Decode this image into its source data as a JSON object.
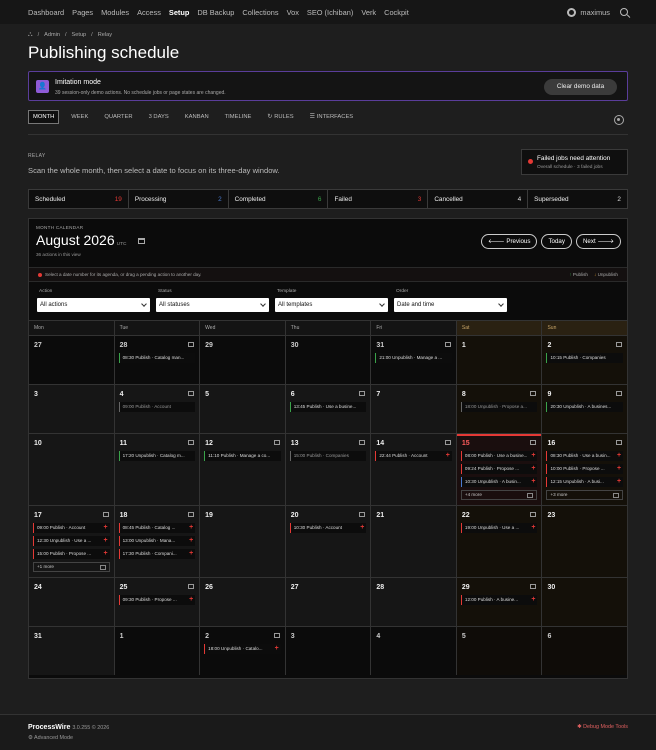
{
  "nav": {
    "items": [
      {
        "label": "Dashboard",
        "active": false
      },
      {
        "label": "Pages",
        "active": false
      },
      {
        "label": "Modules",
        "active": false
      },
      {
        "label": "Access",
        "active": false
      },
      {
        "label": "Setup",
        "active": true
      },
      {
        "label": "DB Backup",
        "active": false
      },
      {
        "label": "Collections",
        "active": false
      },
      {
        "label": "Vox",
        "active": false
      },
      {
        "label": "SEO (Ichiban)",
        "active": false
      },
      {
        "label": "Verk",
        "active": false
      },
      {
        "label": "Cockpit",
        "active": false
      }
    ],
    "user": "maximus",
    "user_icon": "user-circle-icon",
    "search_icon": "search-icon"
  },
  "breadcrumb": {
    "home_icon": "sitemap-icon",
    "items": [
      "Admin",
      "Setup",
      "Relay"
    ],
    "separator": "/"
  },
  "page_title": "Publishing schedule",
  "notice": {
    "icon": "user-icon",
    "title": "Imitation mode",
    "text": "39 session-only demo actions. No schedule jobs or page states are changed.",
    "button": "Clear demo data",
    "accent": "#8e5bd6"
  },
  "tabs": [
    {
      "label": "MONTH",
      "active": true,
      "icon": ""
    },
    {
      "label": "WEEK",
      "active": false,
      "icon": ""
    },
    {
      "label": "QUARTER",
      "active": false,
      "icon": ""
    },
    {
      "label": "3 DAYS",
      "active": false,
      "icon": ""
    },
    {
      "label": "KANBAN",
      "active": false,
      "icon": ""
    },
    {
      "label": "TIMELINE",
      "active": false,
      "icon": ""
    },
    {
      "label": "RULES",
      "active": false,
      "icon": "↻"
    },
    {
      "label": "INTERFACES",
      "active": false,
      "icon": "☰"
    }
  ],
  "settings_icon": "gear-icon",
  "relay": {
    "label": "RELAY",
    "text": "Scan the whole month, then select a date to focus on its three-day window."
  },
  "failed_alert": {
    "title": "Failed jobs need attention",
    "subtitle": "Overall schedule · 3 failed jobs"
  },
  "stats": [
    {
      "label": "Scheduled",
      "count": "19",
      "color": "#e53935"
    },
    {
      "label": "Processing",
      "count": "2",
      "color": "#4a7bd0"
    },
    {
      "label": "Completed",
      "count": "6",
      "color": "#3aa34a"
    },
    {
      "label": "Failed",
      "count": "3",
      "color": "#e53935"
    },
    {
      "label": "Cancelled",
      "count": "4",
      "color": "#dddddd"
    },
    {
      "label": "Superseded",
      "count": "2",
      "color": "#dddddd"
    }
  ],
  "calendar": {
    "kicker": "MONTH CALENDAR",
    "month": "August 2026",
    "tz": "UTC",
    "count": "36 actions in this view",
    "buttons": {
      "prev": "Previous",
      "today": "Today",
      "next": "Next"
    },
    "hint": "Select a date number for its agenda, or drag a pending action to another day.",
    "legend": {
      "publish": "Publish",
      "unpublish": "Unpublish",
      "publish_color": "#3aa34a",
      "unpublish_color": "#e0a030"
    },
    "filters": [
      {
        "label": "Action",
        "value": "All actions"
      },
      {
        "label": "Status",
        "value": "All statuses"
      },
      {
        "label": "Template",
        "value": "All templates"
      },
      {
        "label": "Order",
        "value": "Date and time"
      }
    ],
    "weekdays": [
      "Mon",
      "Tue",
      "Wed",
      "Thu",
      "Fri",
      "Sat",
      "Sun"
    ],
    "weeks": [
      [
        {
          "day": "27",
          "dim": true,
          "cal": false,
          "events": []
        },
        {
          "day": "28",
          "dim": true,
          "cal": true,
          "events": [
            {
              "text": "08:30 Publish · Catalog man...",
              "type": "pub",
              "plus": false
            }
          ]
        },
        {
          "day": "29",
          "dim": true,
          "cal": false,
          "events": []
        },
        {
          "day": "30",
          "dim": true,
          "cal": false,
          "events": []
        },
        {
          "day": "31",
          "dim": true,
          "cal": true,
          "events": [
            {
              "text": "21:00 Unpublish · Manage a ...",
              "type": "pub",
              "plus": false
            }
          ]
        },
        {
          "day": "1",
          "dim": false,
          "cal": false,
          "events": []
        },
        {
          "day": "2",
          "dim": false,
          "cal": true,
          "events": [
            {
              "text": "10:15 Publish · Companies",
              "type": "pub",
              "plus": false
            }
          ]
        }
      ],
      [
        {
          "day": "3",
          "dim": false,
          "cal": false,
          "events": []
        },
        {
          "day": "4",
          "dim": false,
          "cal": true,
          "events": [
            {
              "text": "09:00 Publish · Account",
              "type": "done",
              "plus": false
            }
          ]
        },
        {
          "day": "5",
          "dim": false,
          "cal": false,
          "events": []
        },
        {
          "day": "6",
          "dim": false,
          "cal": true,
          "events": [
            {
              "text": "13:45 Publish · Use a busine...",
              "type": "pub",
              "plus": false
            }
          ]
        },
        {
          "day": "7",
          "dim": false,
          "cal": false,
          "events": []
        },
        {
          "day": "8",
          "dim": false,
          "cal": true,
          "events": [
            {
              "text": "18:00 Unpublish · Propose a...",
              "type": "done",
              "plus": false
            }
          ]
        },
        {
          "day": "9",
          "dim": false,
          "cal": true,
          "events": [
            {
              "text": "20:30 Unpublish · A busines...",
              "type": "pub",
              "plus": false
            }
          ]
        }
      ],
      [
        {
          "day": "10",
          "dim": false,
          "cal": false,
          "events": []
        },
        {
          "day": "11",
          "dim": false,
          "cal": true,
          "events": [
            {
              "text": "17:20 Unpublish · Catalog m...",
              "type": "pub",
              "plus": false
            }
          ]
        },
        {
          "day": "12",
          "dim": false,
          "cal": true,
          "events": [
            {
              "text": "11:10 Publish · Manage a co...",
              "type": "pub",
              "plus": false
            }
          ]
        },
        {
          "day": "13",
          "dim": false,
          "cal": true,
          "events": [
            {
              "text": "15:00 Publish · Companies",
              "type": "done",
              "plus": false
            }
          ]
        },
        {
          "day": "14",
          "dim": false,
          "cal": true,
          "events": [
            {
              "text": "22:44 Publish · Account",
              "type": "unpub",
              "plus": true
            }
          ]
        },
        {
          "day": "15",
          "dim": false,
          "cal": true,
          "today": true,
          "events": [
            {
              "text": "08:00 Publish · Use a busine...",
              "type": "unpub",
              "plus": true
            },
            {
              "text": "09:24 Publish · Propose ...",
              "type": "unpub",
              "plus": true
            },
            {
              "text": "10:30 Unpublish · A busin...",
              "type": "info",
              "plus": true
            }
          ],
          "more": "+4 more"
        },
        {
          "day": "16",
          "dim": false,
          "cal": true,
          "events": [
            {
              "text": "08:30 Publish · Use a busin...",
              "type": "unpub",
              "plus": true
            },
            {
              "text": "10:00 Publish · Propose ...",
              "type": "unpub",
              "plus": true
            },
            {
              "text": "12:15 Unpublish · A busi...",
              "type": "unpub",
              "plus": true
            }
          ],
          "more": "+3 more"
        }
      ],
      [
        {
          "day": "17",
          "dim": false,
          "cal": true,
          "events": [
            {
              "text": "09:00 Publish · Account",
              "type": "unpub",
              "plus": true
            },
            {
              "text": "12:30 Unpublish · Use a ...",
              "type": "unpub",
              "plus": true
            },
            {
              "text": "15:00 Publish · Propose ...",
              "type": "unpub",
              "plus": true
            }
          ],
          "more": "+1 more"
        },
        {
          "day": "18",
          "dim": false,
          "cal": true,
          "events": [
            {
              "text": "08:45 Publish · Catalog ...",
              "type": "unpub",
              "plus": true
            },
            {
              "text": "13:00 Unpublish · Mana...",
              "type": "unpub",
              "plus": true
            },
            {
              "text": "17:30 Publish · Compani...",
              "type": "unpub",
              "plus": true
            }
          ]
        },
        {
          "day": "19",
          "dim": false,
          "cal": false,
          "events": []
        },
        {
          "day": "20",
          "dim": false,
          "cal": true,
          "events": [
            {
              "text": "10:30 Publish · Account",
              "type": "unpub",
              "plus": true
            }
          ]
        },
        {
          "day": "21",
          "dim": false,
          "cal": false,
          "events": []
        },
        {
          "day": "22",
          "dim": false,
          "cal": true,
          "events": [
            {
              "text": "19:00 Unpublish · Use a ...",
              "type": "unpub",
              "plus": true
            }
          ]
        },
        {
          "day": "23",
          "dim": false,
          "cal": false,
          "events": []
        }
      ],
      [
        {
          "day": "24",
          "dim": false,
          "cal": false,
          "events": []
        },
        {
          "day": "25",
          "dim": false,
          "cal": true,
          "events": [
            {
              "text": "09:30 Publish · Propose ...",
              "type": "unpub",
              "plus": true
            }
          ]
        },
        {
          "day": "26",
          "dim": false,
          "cal": false,
          "events": []
        },
        {
          "day": "27",
          "dim": false,
          "cal": false,
          "events": []
        },
        {
          "day": "28",
          "dim": false,
          "cal": false,
          "events": []
        },
        {
          "day": "29",
          "dim": false,
          "cal": true,
          "events": [
            {
              "text": "12:00 Publish · A busine...",
              "type": "unpub",
              "plus": true
            }
          ]
        },
        {
          "day": "30",
          "dim": false,
          "cal": false,
          "events": []
        }
      ],
      [
        {
          "day": "31",
          "dim": false,
          "cal": false,
          "events": []
        },
        {
          "day": "1",
          "dim": true,
          "cal": false,
          "events": []
        },
        {
          "day": "2",
          "dim": true,
          "cal": true,
          "events": [
            {
              "text": "18:00 Unpublish · Catalo...",
              "type": "unpub",
              "plus": true
            }
          ]
        },
        {
          "day": "3",
          "dim": true,
          "cal": false,
          "events": []
        },
        {
          "day": "4",
          "dim": true,
          "cal": false,
          "events": []
        },
        {
          "day": "5",
          "dim": true,
          "cal": false,
          "events": []
        },
        {
          "day": "6",
          "dim": true,
          "cal": false,
          "events": []
        }
      ]
    ]
  },
  "footer": {
    "brand": "ProcessWire",
    "version": "3.0.255 © 2026",
    "mode": "Advanced Mode",
    "debug": "Debug Mode Tools"
  }
}
